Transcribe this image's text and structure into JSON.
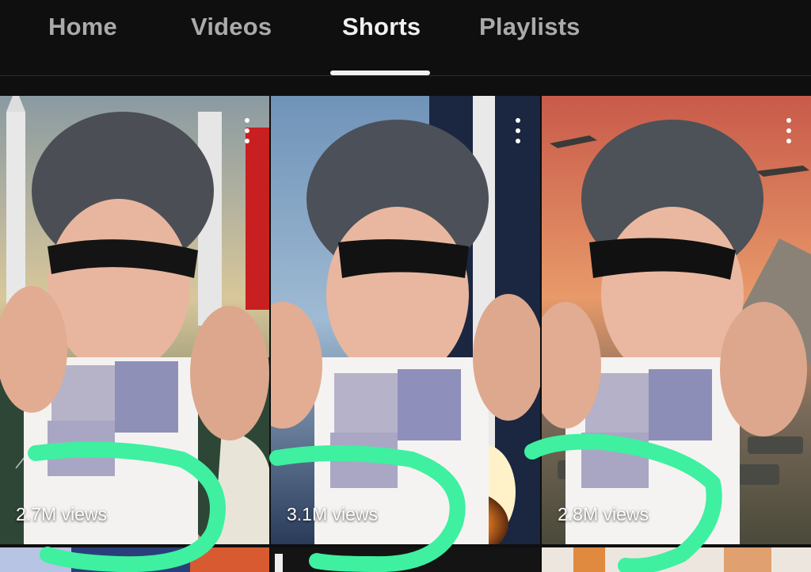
{
  "tabs": [
    {
      "label": "Home",
      "active": false
    },
    {
      "label": "Videos",
      "active": false
    },
    {
      "label": "Shorts",
      "active": true
    },
    {
      "label": "Playlists",
      "active": false
    }
  ],
  "shorts": [
    {
      "views": "2.7M views"
    },
    {
      "views": "3.1M views"
    },
    {
      "views": "2.8M views"
    }
  ],
  "colors": {
    "background": "#0f0f0f",
    "tab_active": "#f1f1f1",
    "tab_inactive": "#aaaaaa",
    "annotation_marker": "#3ef0a0"
  },
  "icons": [
    "more-vert-icon"
  ]
}
